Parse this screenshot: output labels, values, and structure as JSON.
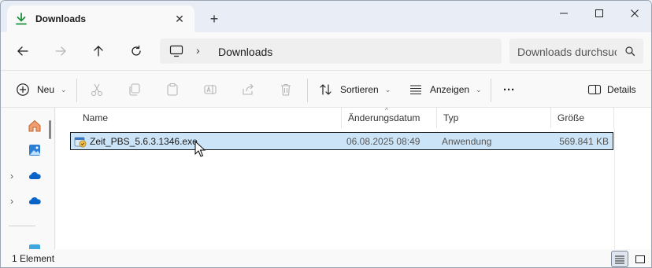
{
  "tab": {
    "title": "Downloads",
    "close_label": "✕",
    "new_tab_label": "+"
  },
  "address": {
    "path_segment": "Downloads"
  },
  "search": {
    "placeholder": "Downloads durchsuchen"
  },
  "commands": {
    "new_label": "Neu",
    "sort_label": "Sortieren",
    "view_label": "Anzeigen",
    "more_label": "···",
    "details_label": "Details"
  },
  "columns": {
    "name": "Name",
    "date": "Änderungsdatum",
    "type": "Typ",
    "size": "Größe"
  },
  "files": [
    {
      "name": "Zeit_PBS_5.6.3.1346.exe",
      "date": "06.08.2025 08:49",
      "type": "Anwendung",
      "size": "569.841 KB"
    }
  ],
  "status": {
    "count_text": "1 Element"
  },
  "colors": {
    "accent": "#0067c0",
    "selection": "#cce4f7",
    "download_arrow": "#1a8f3c"
  },
  "icons": {
    "tab": "download-arrow-icon",
    "nav": [
      "home-icon",
      "gallery-icon",
      "onedrive-icon",
      "onedrive-icon"
    ]
  }
}
